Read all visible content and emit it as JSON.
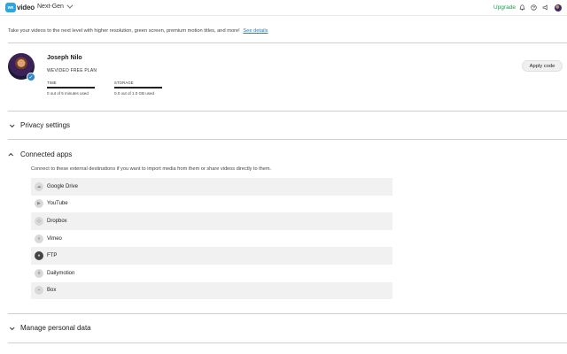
{
  "header": {
    "logo_badge": "we",
    "logo_text": "video",
    "workspace": "Next-Gen",
    "upgrade": "Upgrade",
    "icons": [
      "bell-icon",
      "help-icon",
      "notifications-icon",
      "user-avatar"
    ]
  },
  "promo": {
    "text": "Take your videos to the next level with higher resolution, green screen, premium motion titles, and more!",
    "link": "See details"
  },
  "profile": {
    "name": "Joseph Nilo",
    "plan": "WEVIDEO FREE PLAN",
    "time_label": "TIME",
    "time_value": "0 out of 5 minutes used",
    "storage_label": "STORAGE",
    "storage_value": "0.0 out of 1.0 GB used",
    "apply_code": "Apply code"
  },
  "sections": {
    "privacy": "Privacy settings",
    "connected": "Connected apps",
    "connected_desc": "Connect to these external destinations if you want to import media from them or share videos directly to them.",
    "manage": "Manage personal data"
  },
  "apps": [
    {
      "label": "Google Drive",
      "icon": "cloud-icon"
    },
    {
      "label": "YouTube",
      "icon": "play-icon"
    },
    {
      "label": "Dropbox",
      "icon": "dropbox-icon"
    },
    {
      "label": "Vimeo",
      "icon": "vimeo-icon"
    },
    {
      "label": "FTP",
      "icon": "ftp-icon"
    },
    {
      "label": "Dailymotion",
      "icon": "dailymotion-icon"
    },
    {
      "label": "Box",
      "icon": "box-icon"
    }
  ],
  "colors": {
    "accent": "#2da6e0",
    "upgrade": "#1e9d4a",
    "link": "#2a7ab8"
  }
}
